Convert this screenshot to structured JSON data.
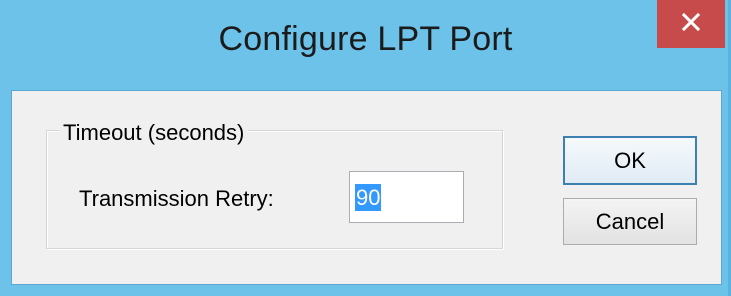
{
  "window": {
    "title": "Configure LPT Port",
    "close_icon": "close-icon"
  },
  "timeout_group": {
    "legend": "Timeout (seconds)",
    "transmission_retry_label": "Transmission Retry:",
    "transmission_retry_value": "90"
  },
  "buttons": {
    "ok_label": "OK",
    "cancel_label": "Cancel"
  },
  "colors": {
    "frame": "#6dc2e9",
    "close_button": "#c74b4b",
    "selection": "#3399ff",
    "client_background": "#f0f0f0"
  }
}
